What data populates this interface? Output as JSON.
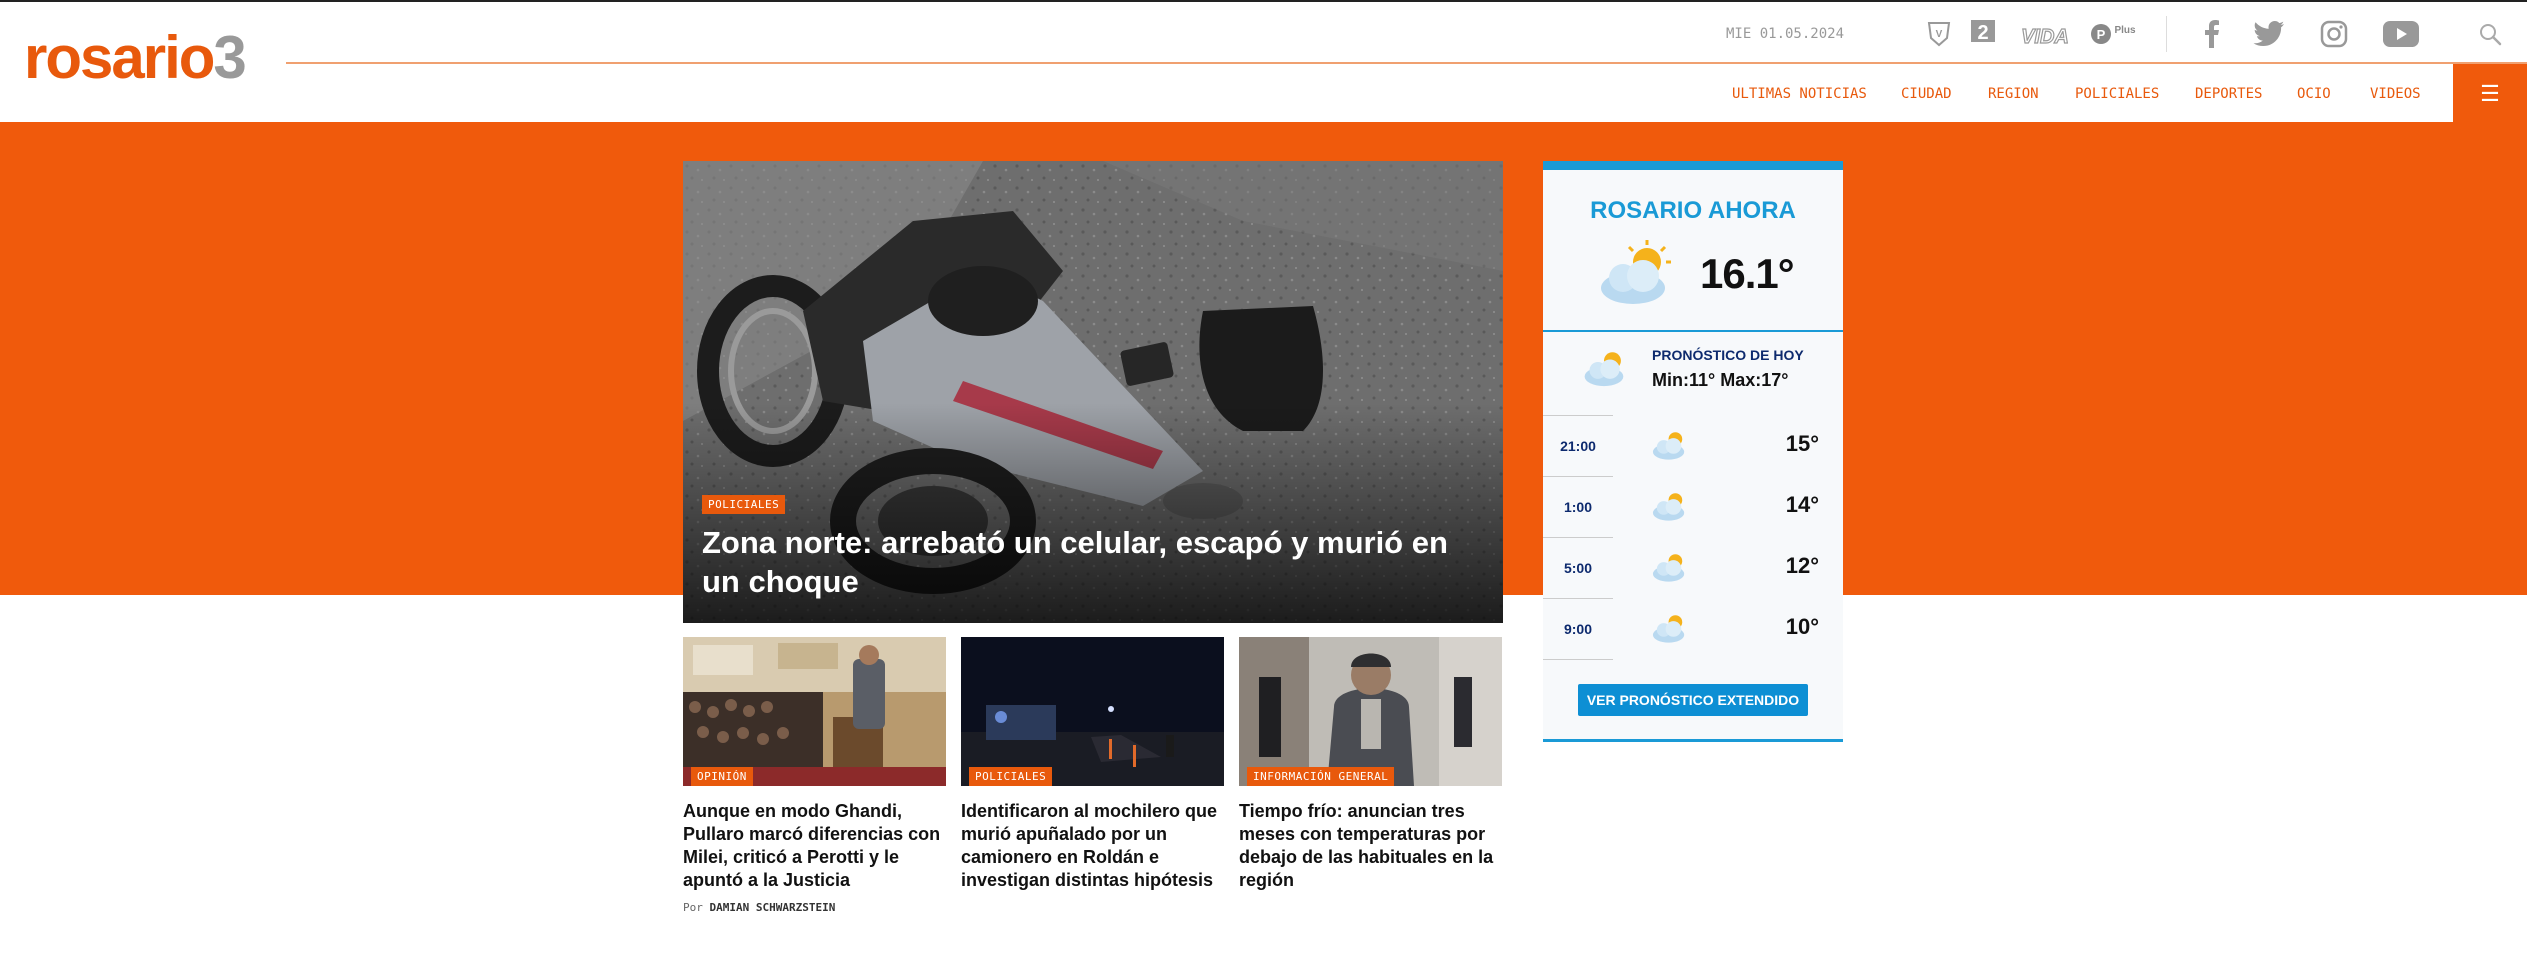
{
  "header": {
    "logo_main": "rosario",
    "logo_num": "3",
    "date": "MIE 01.05.2024",
    "brands": [
      "V",
      "2",
      "VIDA",
      "Plus"
    ],
    "socials": [
      "facebook-icon",
      "twitter-icon",
      "instagram-icon",
      "youtube-icon",
      "search-icon"
    ]
  },
  "nav": {
    "items": [
      "ULTIMAS NOTICIAS",
      "CIUDAD",
      "REGION",
      "POLICIALES",
      "DEPORTES",
      "OCIO",
      "VIDEOS"
    ],
    "menu_icon": "☰"
  },
  "hero": {
    "tag": "POLICIALES",
    "title": "Zona norte: arrebató un celular, escapó y murió en un choque"
  },
  "cards": [
    {
      "tag": "OPINIÓN",
      "title": "Aunque en modo Ghandi, Pullaro marcó diferencias con Milei, criticó a Perotti y le apuntó a la Justicia",
      "byline_prefix": "Por",
      "byline_author": "DAMIAN SCHWARZSTEIN"
    },
    {
      "tag": "POLICIALES",
      "title": "Identificaron al mochilero que murió apuñalado por un camionero en Roldán e investigan distintas hipótesis"
    },
    {
      "tag": "INFORMACIÓN GENERAL",
      "title": "Tiempo frío: anuncian tres meses con temperaturas por debajo de las habituales en la región"
    }
  ],
  "weather": {
    "title": "ROSARIO AHORA",
    "current_temp": "16.1°",
    "forecast_label": "PRONÓSTICO DE HOY",
    "forecast_minmax": "Min:11° Max:17°",
    "hours": [
      {
        "hour": "21:00",
        "temp": "15°"
      },
      {
        "hour": "1:00",
        "temp": "14°"
      },
      {
        "hour": "5:00",
        "temp": "12°"
      },
      {
        "hour": "9:00",
        "temp": "10°"
      }
    ],
    "button": "VER PRONÓSTICO EXTENDIDO",
    "accent": "#1a9ad6"
  },
  "colors": {
    "brand_orange": "#f05a0c",
    "nav_text": "#e8590c",
    "weather_blue": "#1a9ad6"
  }
}
